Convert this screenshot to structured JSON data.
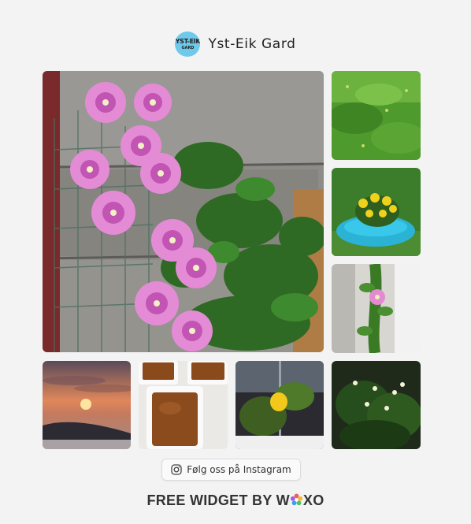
{
  "profile": {
    "name": "Yst-Eik Gard",
    "avatar_line1": "YST-EIK",
    "avatar_line2": "GARD"
  },
  "gallery": {
    "items": [
      {
        "icon": "clematis-pink-flowers-photo"
      },
      {
        "icon": "green-grass-field-photo"
      },
      {
        "icon": "yellow-flowers-blue-tyre-planter-photo"
      },
      {
        "icon": "clematis-vine-on-wall-photo"
      },
      {
        "icon": "sunset-over-lake-photo"
      },
      {
        "icon": "caramel-dessert-trays-photo"
      },
      {
        "icon": "yellow-pepper-plant-photo"
      },
      {
        "icon": "white-flowering-plant-photo"
      }
    ]
  },
  "follow_button": {
    "label": "Følg oss på Instagram",
    "icon": "instagram-icon"
  },
  "footer": {
    "prefix": "FREE WIDGET BY W",
    "suffix": "XO",
    "logo_icon": "woxo-flower-icon"
  },
  "colors": {
    "background": "#f3f3f4",
    "avatar_bg": "#6ec9ea",
    "text": "#222222"
  }
}
